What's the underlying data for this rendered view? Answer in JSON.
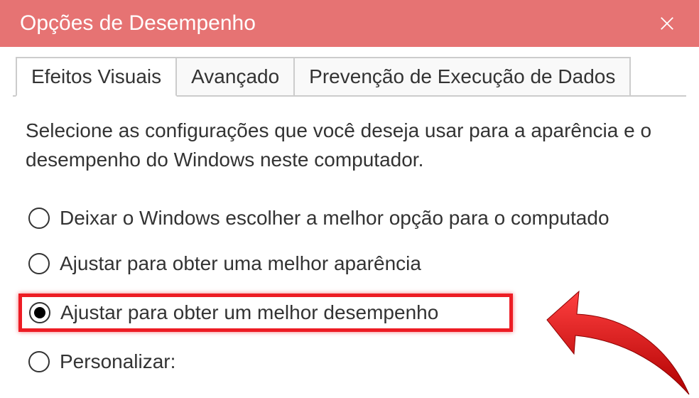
{
  "window": {
    "title": "Opções de Desempenho"
  },
  "tabs": {
    "visual_effects": "Efeitos Visuais",
    "advanced": "Avançado",
    "dep": "Prevenção de Execução de Dados"
  },
  "panel": {
    "description": "Selecione as configurações que você deseja usar para a aparência e o desempenho do Windows neste computador."
  },
  "radio": {
    "let_windows": "Deixar o Windows escolher a melhor opção para o computado",
    "best_appearance": "Ajustar para obter uma melhor aparência",
    "best_performance": "Ajustar para obter um melhor desempenho",
    "custom": "Personalizar:"
  },
  "annotation": {
    "highlight_color": "#ed1c24"
  }
}
